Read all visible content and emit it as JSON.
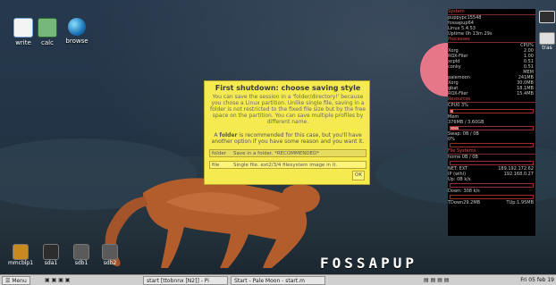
{
  "desktop": {
    "icons": [
      {
        "label": "write",
        "icon": "document-icon"
      },
      {
        "label": "calc",
        "icon": "spreadsheet-icon"
      },
      {
        "label": "browse",
        "icon": "globe-icon"
      }
    ],
    "drives": [
      {
        "label": "mmcblp1",
        "icon": "memory-card-icon"
      },
      {
        "label": "sda1",
        "icon": "drive-icon"
      },
      {
        "label": "sdb1",
        "icon": "usb-drive-icon"
      },
      {
        "label": "sdb2",
        "icon": "usb-drive-icon"
      }
    ],
    "logo_text": "FOSSAPUP"
  },
  "dialog": {
    "title": "First shutdown: choose saving style",
    "para1": "You can save the session in a 'folder/directory!' because you chose a Linux partition. Unlike single file, saving in a folder is not restricted to the fixed file size but by the free space on the partition. You can save multiple profiles by different name.",
    "para2_prefix": "A",
    "para2_strong": "folder",
    "para2_rest": "is recommended for this case, but you'll have another option if you have some reason and you want it.",
    "options": [
      {
        "key": "folder",
        "value": "Save in a folder. *RECOMMENDED*"
      },
      {
        "key": "file",
        "value": "Single file. ext2/3/4 filesystem image in it."
      }
    ],
    "ok_label": "OK"
  },
  "conky": {
    "system_header": "System",
    "system_lines": [
      "puppypc15548",
      "fossapup64",
      "Linux 5.4.53",
      "Uptime 0h 13m 29s"
    ],
    "processes_header": "Processes",
    "processes_cpu_header": "CPU%",
    "processes_cpu": [
      {
        "name": "Xorg",
        "value": "2.00"
      },
      {
        "name": "ROX-Filer",
        "value": "1.00"
      },
      {
        "name": "xcpld",
        "value": "0.51"
      },
      {
        "name": "conky",
        "value": "0.51"
      }
    ],
    "processes_mem_header": "MEM",
    "processes_mem": [
      {
        "name": "palemoon",
        "value": "241MB"
      },
      {
        "name": "Xorg",
        "value": "30.0MB"
      },
      {
        "name": "gbat",
        "value": "18.1MB"
      },
      {
        "name": "ROX-Filer",
        "value": "15.4MB"
      }
    ],
    "resources_header": "Resources",
    "cpu_label": "CPU0 3%",
    "cpu_level": 0.03,
    "mem_label": "Mem",
    "mem_value": "376MB / 3.60GB",
    "mem_level": 0.1,
    "swap_label": "Swap: 0B / 0B",
    "swap_level": 0.0,
    "swap_pct": "0%",
    "fs_header": "File Systems",
    "fs_line": "home 0B / 0B",
    "fs_level": 0.0,
    "net_line": "NET: EXT",
    "net_ip": "189.192.172.62",
    "ip_label": "IP (wlhi)",
    "ip_value": "192.168.0.27",
    "up_label": "Up: 0B",
    "up_unit": "k/s",
    "down_label": "Down: 308",
    "down_unit": "k/s",
    "totals_down": "TDown29.2MB",
    "totals_up": "TUp:1.95MB"
  },
  "right_dock": [
    {
      "label": "",
      "icon": "terminal-icon"
    },
    {
      "label": "tras",
      "icon": "trash-icon"
    }
  ],
  "taskbar": {
    "menu_label": "Menu",
    "tasks": [
      "start [ttobnnx [N2]] - Pi",
      "Start - Pale Moon - start.m"
    ],
    "clock": "Fri 05 feb 19"
  },
  "colors": {
    "dialog_bg": "#f5ea4f",
    "conky_bg": "#000000",
    "conky_accent": "#e24e4e",
    "sun": "#f07a8b"
  }
}
